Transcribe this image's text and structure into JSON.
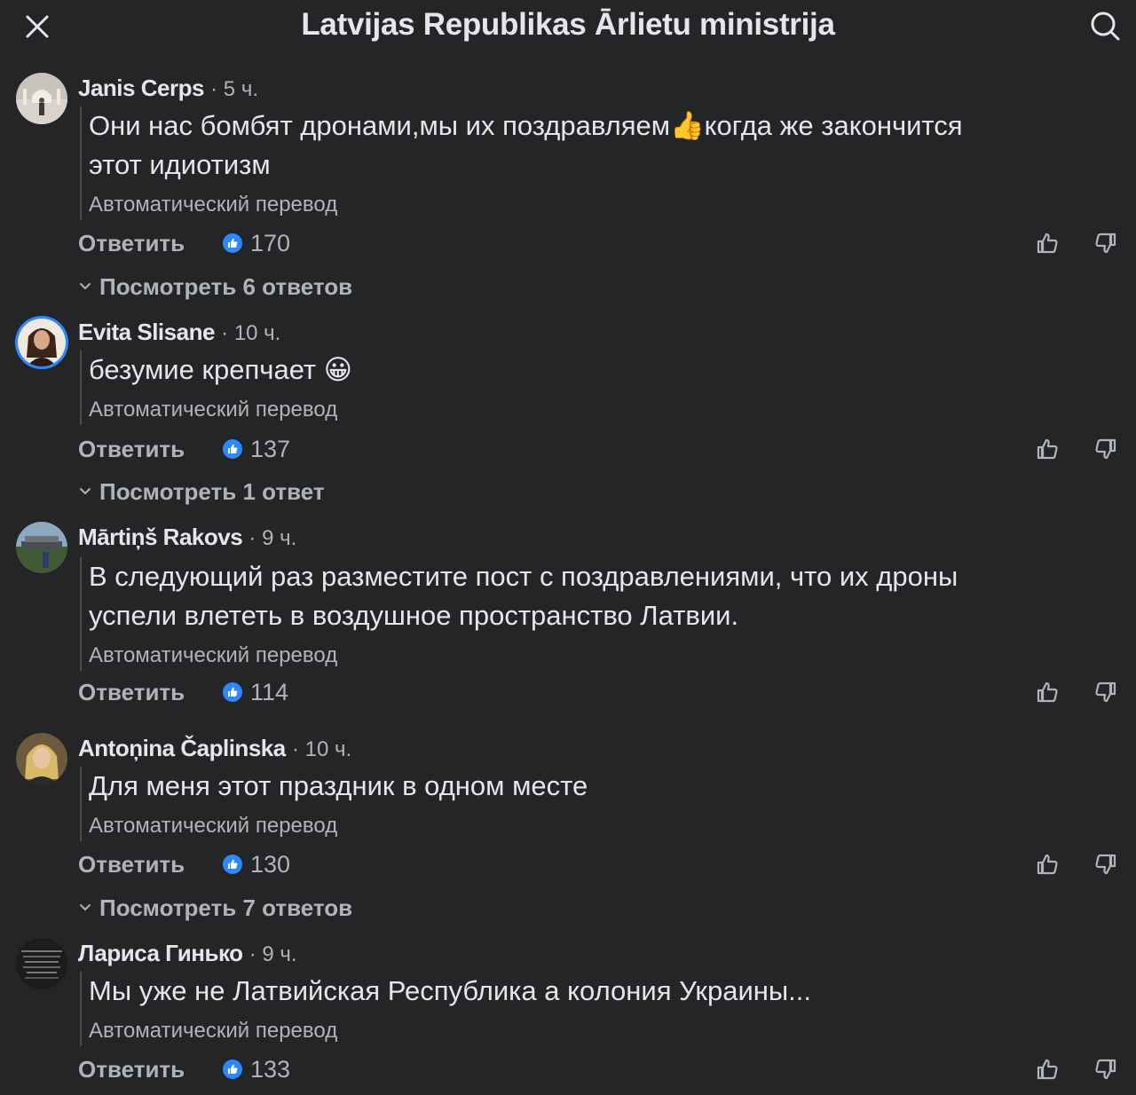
{
  "header": {
    "title": "Latvijas Republikas Ārlietu ministrija"
  },
  "common": {
    "translated": "Автоматический перевод",
    "reply": "Ответить"
  },
  "comments": [
    {
      "author": "Janis Cerps",
      "time": "· 5 ч.",
      "text": "Они нас бомбят дронами,мы их поздравляем👍когда же закончится\nэтот идиотизм",
      "likes": "170",
      "replies": "Посмотреть 6 ответов"
    },
    {
      "author": "Evita Slisane",
      "time": "· 10 ч.",
      "text": "безумие крепчает 😀",
      "likes": "137",
      "replies": "Посмотреть 1 ответ"
    },
    {
      "author": "Mārtiņš Rakovs",
      "time": "· 9 ч.",
      "text": "В следующий раз разместите пост с поздравлениями, что их дроны\nуспели влететь в воздушное пространство Латвии.",
      "likes": "114"
    },
    {
      "author": "Antoņina Čaplinska",
      "time": "· 10 ч.",
      "text": "Для меня этот праздник в одном месте",
      "likes": "130",
      "replies": "Посмотреть 7 ответов"
    },
    {
      "author": "Лариса Гинько",
      "time": "· 9 ч.",
      "text": "Мы уже не Латвийская Республика а колония Украины...",
      "likes": "133"
    }
  ],
  "colors": {
    "background": "#242526",
    "accent": "#2d88ff",
    "text_primary": "#e4e6eb",
    "text_secondary": "#b0b3b8"
  }
}
